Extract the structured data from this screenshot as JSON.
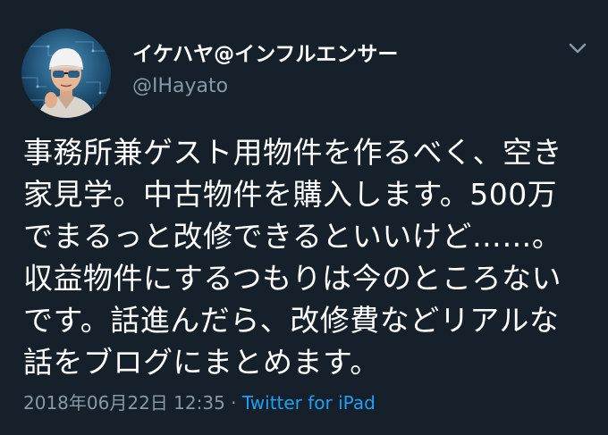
{
  "tweet": {
    "display_name": "イケハヤ@インフルエンサー",
    "handle": "@IHayato",
    "body": "事務所兼ゲスト用物件を作るべく、空き\n家見学。中古物件を購入します。500万\nでまるっと改修できるといいけど……。\n収益物件にするつもりは今のところない\nです。話進んだら、改修費などリアルな\n話をブログにまとめます。",
    "timestamp": "2018年06月22日 12:35",
    "separator": "·",
    "source": "Twitter for iPad"
  },
  "icons": {
    "menu": "chevron-down-icon",
    "avatar": "user-avatar"
  },
  "colors": {
    "background": "#15202b",
    "text": "#ffffff",
    "muted": "#8899a6",
    "link": "#1da1f2"
  }
}
